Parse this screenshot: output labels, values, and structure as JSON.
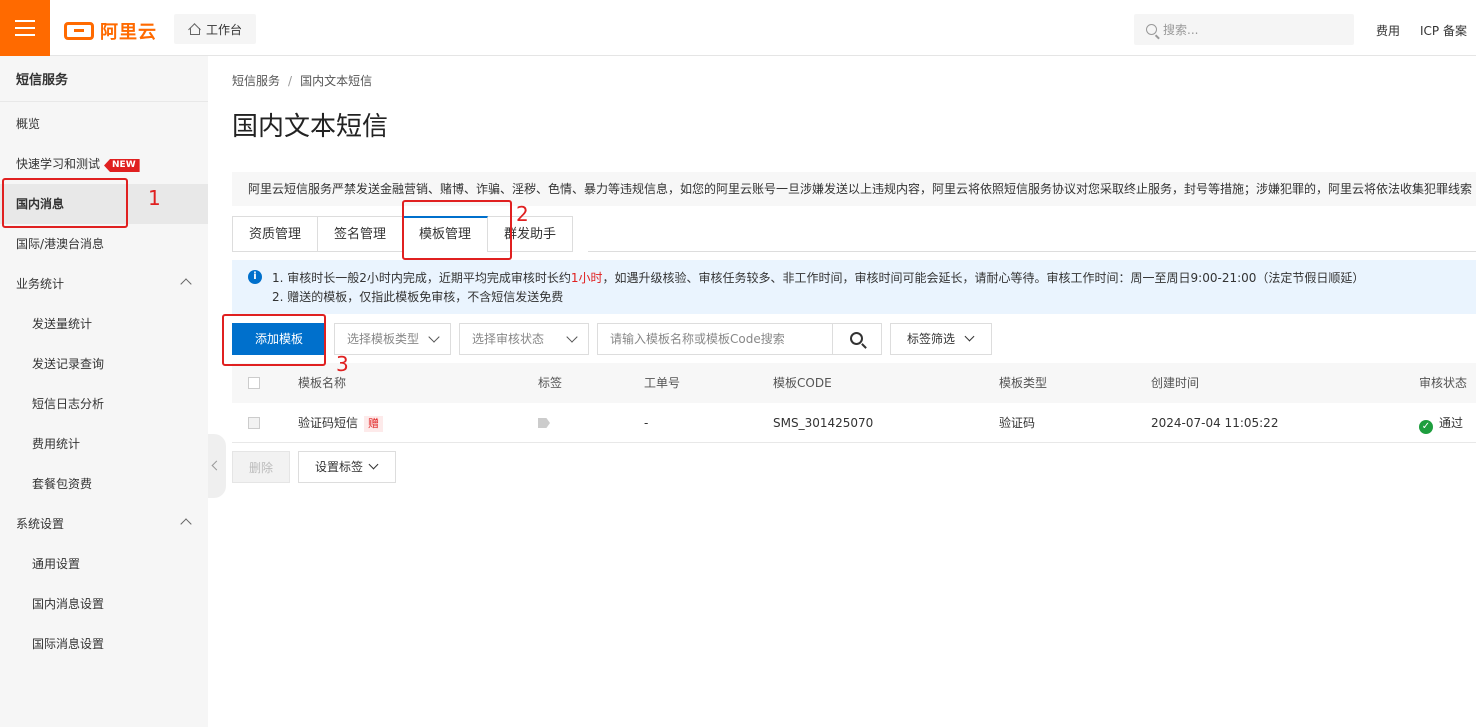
{
  "topbar": {
    "logo_text": "阿里云",
    "workbench_label": "工作台",
    "search_placeholder": "搜索...",
    "links": [
      "费用",
      "ICP 备案"
    ]
  },
  "sidebar": {
    "title": "短信服务",
    "items": [
      {
        "label": "概览"
      },
      {
        "label": "快速学习和测试",
        "badge": "NEW"
      },
      {
        "label": "国内消息",
        "active": true
      },
      {
        "label": "国际/港澳台消息"
      },
      {
        "label": "业务统计",
        "expanded": true
      },
      {
        "label": "发送量统计"
      },
      {
        "label": "发送记录查询"
      },
      {
        "label": "短信日志分析"
      },
      {
        "label": "费用统计"
      },
      {
        "label": "套餐包资费"
      },
      {
        "label": "系统设置",
        "expanded": true
      },
      {
        "label": "通用设置"
      },
      {
        "label": "国内消息设置"
      },
      {
        "label": "国际消息设置"
      }
    ]
  },
  "breadcrumb": [
    "短信服务",
    "国内文本短信"
  ],
  "breadcrumb_sep": "/",
  "page_title": "国内文本短信",
  "warning": "阿里云短信服务严禁发送金融营销、赌博、诈骗、淫秽、色情、暴力等违规信息，如您的阿里云账号一旦涉嫌发送以上违规内容，阿里云将依照短信服务协议对您采取终止服务，封号等措施；涉嫌犯罪的，阿里云将依法收集犯罪线索",
  "tabs": [
    {
      "label": "资质管理"
    },
    {
      "label": "签名管理"
    },
    {
      "label": "模板管理",
      "active": true
    },
    {
      "label": "群发助手"
    }
  ],
  "notice": {
    "line1_a": "1. 审核时长一般2小时内完成，近期平均完成审核时长约",
    "line1_red": "1小时",
    "line1_b": "，如遇升级核验、审核任务较多、非工作时间，审核时间可能会延长，请耐心等待。审核工作时间：周一至周日9:00-21:00（法定节假日顺延）",
    "line2": "2. 赠送的模板，仅指此模板免审核，不含短信发送免费"
  },
  "toolbar": {
    "add_label": "添加模板",
    "type_select_placeholder": "选择模板类型",
    "status_select_placeholder": "选择审核状态",
    "search_placeholder": "请输入模板名称或模板Code搜索",
    "tag_filter_label": "标签筛选"
  },
  "table": {
    "columns": [
      "模板名称",
      "标签",
      "工单号",
      "模板CODE",
      "模板类型",
      "创建时间",
      "审核状态"
    ],
    "rows": [
      {
        "name": "验证码短信",
        "gift_badge": "赠",
        "order_no": "-",
        "code": "SMS_301425070",
        "type": "验证码",
        "created": "2024-07-04 11:05:22",
        "status": "通过"
      }
    ]
  },
  "footer_actions": {
    "delete_label": "删除",
    "set_tag_label": "设置标签"
  },
  "annotations": [
    "1",
    "2",
    "3"
  ],
  "colors": {
    "brand_orange": "#ff6a00",
    "primary_blue": "#0070cc",
    "annotation_red": "#e02020",
    "success_green": "#1e9e3e"
  }
}
